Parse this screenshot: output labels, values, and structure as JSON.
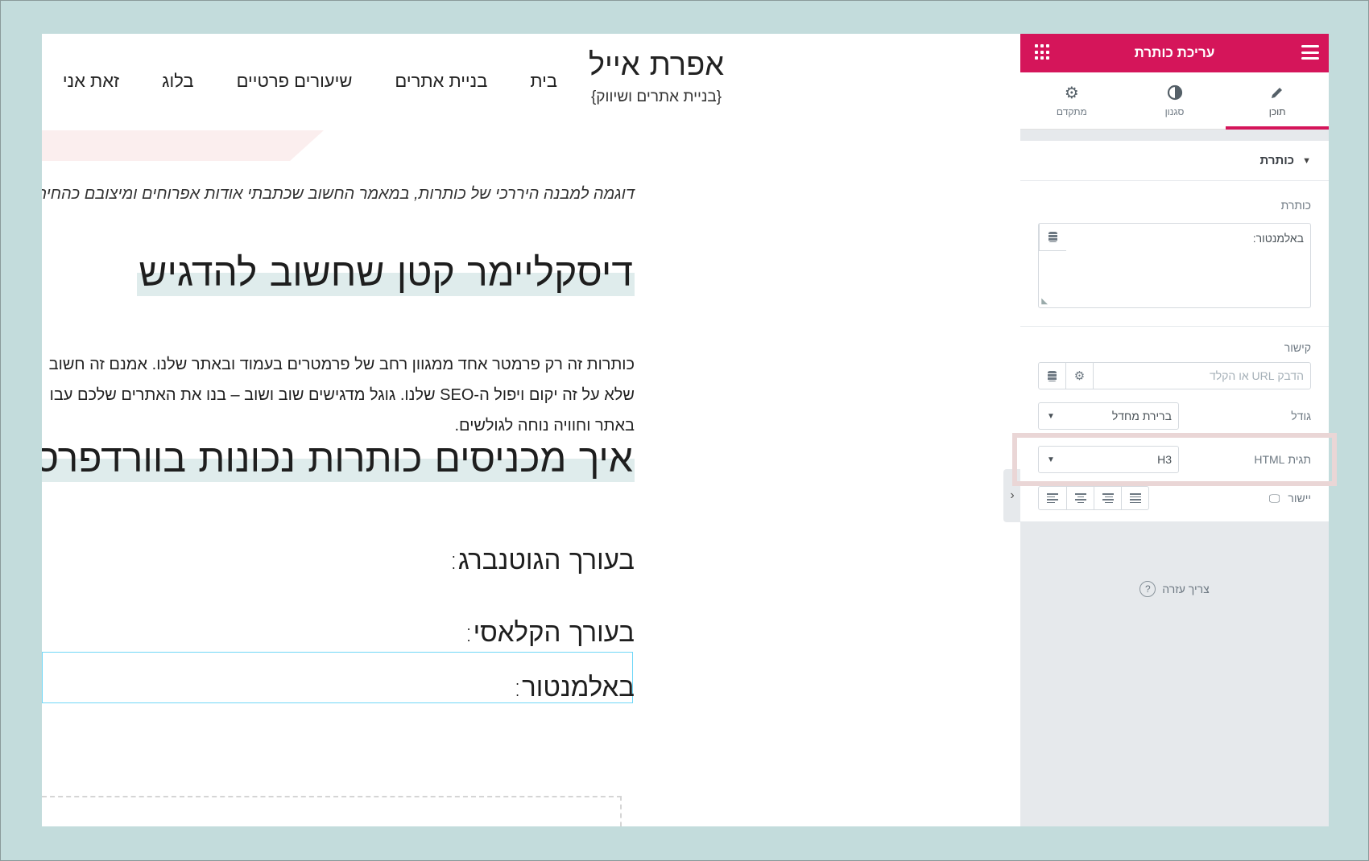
{
  "site": {
    "title": "אפרת אייל",
    "tagline": "{בניית אתרים ושיווק}"
  },
  "nav": [
    "בית",
    "בניית אתרים",
    "שיעורים פרטיים",
    "בלוג",
    "זאת אני"
  ],
  "article": {
    "caption": "דוגמה למבנה היררכי של כותרות, במאמר החשוב שכתבתי אודות אפרוחים ומיצובם כהחיה החמודה",
    "heading1": "דיסקליימר קטן שחשוב להדגיש",
    "paragraph": [
      "כותרות זה רק פרמטר אחד ממגוון רחב של פרמטרים בעמוד ובאתר שלנו. אמנם זה חשוב",
      "שלא על זה יקום ויפול ה-SEO שלנו. גוגל מדגישים שוב ושוב – בנו את האתרים שלכם עבו",
      "באתר וחוויה נוחה לגולשים."
    ],
    "heading2": "איך מכניסים כותרות נכונות בוורדפרס?",
    "sub1": "בעורך הגוטנברג:",
    "sub2": "בעורך הקלאסי:",
    "sub3": "באלמנטור:"
  },
  "panel": {
    "title": "עריכת כותרת",
    "tabs": [
      {
        "label": "תוכן",
        "icon": "pencil-icon",
        "active": true
      },
      {
        "label": "סגנון",
        "icon": "contrast-icon",
        "active": false
      },
      {
        "label": "מתקדם",
        "icon": "gear-icon",
        "active": false
      }
    ],
    "section": "כותרת",
    "title_label": "כותרת",
    "title_value": "באלמנטור:",
    "link_label": "קישור",
    "link_placeholder": "הדבק URL או הקלד",
    "size_label": "גודל",
    "size_value": "ברירת מחדל",
    "html_tag_label": "תגית HTML",
    "html_tag_value": "H3",
    "align_label": "יישור",
    "help": "צריך עזרה",
    "accent": "#d5155a"
  }
}
